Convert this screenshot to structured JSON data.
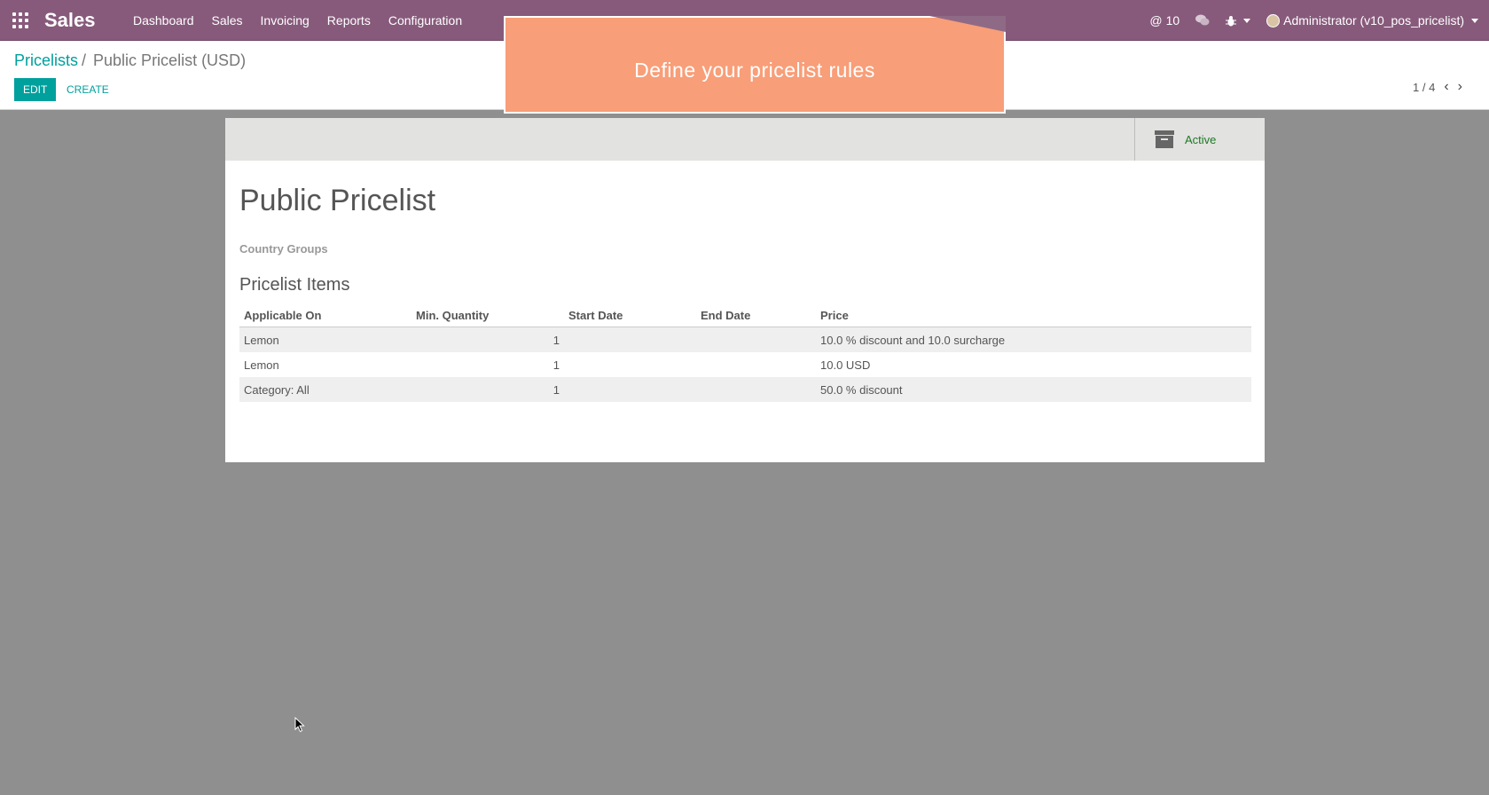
{
  "navbar": {
    "brand": "Sales",
    "menu": [
      "Dashboard",
      "Sales",
      "Invoicing",
      "Reports",
      "Configuration"
    ],
    "mentions_count": "10",
    "user": "Administrator (v10_pos_pricelist)"
  },
  "breadcrumb": {
    "parent": "Pricelists",
    "separator": "/",
    "current": "Public Pricelist (USD)"
  },
  "buttons": {
    "edit": "EDIT",
    "create": "CREATE"
  },
  "pager": {
    "value": "1 / 4"
  },
  "tour": {
    "text": "Define your pricelist rules"
  },
  "form": {
    "active_label": "Active",
    "title": "Public Pricelist",
    "country_groups_label": "Country Groups",
    "items_title": "Pricelist Items",
    "columns": [
      "Applicable On",
      "Min. Quantity",
      "Start Date",
      "End Date",
      "Price"
    ],
    "rows": [
      {
        "applicable_on": "Lemon",
        "min_qty": "1",
        "start": "",
        "end": "",
        "price": "10.0 % discount and 10.0 surcharge"
      },
      {
        "applicable_on": "Lemon",
        "min_qty": "1",
        "start": "",
        "end": "",
        "price": "10.0 USD"
      },
      {
        "applicable_on": "Category: All",
        "min_qty": "1",
        "start": "",
        "end": "",
        "price": "50.0 % discount"
      }
    ]
  }
}
